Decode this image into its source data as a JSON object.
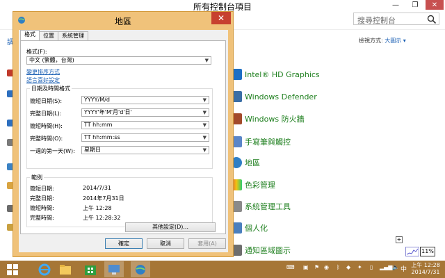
{
  "control_panel": {
    "title": "所有控制台項目",
    "search_placeholder": "搜尋控制台",
    "view_by_label": "檢視方式:",
    "view_by_value": "大圖示",
    "items": [
      {
        "label": "Intel® HD Graphics",
        "icon": "intel-graphics-icon"
      },
      {
        "label": "Windows Defender",
        "icon": "windows-defender-icon"
      },
      {
        "label": "Windows 防火牆",
        "icon": "windows-firewall-icon"
      },
      {
        "label": "手寫筆與觸控",
        "icon": "pen-touch-icon"
      },
      {
        "label": "地區",
        "icon": "region-icon"
      },
      {
        "label": "色彩管理",
        "icon": "color-management-icon"
      },
      {
        "label": "系統管理工具",
        "icon": "admin-tools-icon"
      },
      {
        "label": "個人化",
        "icon": "personalization-icon"
      },
      {
        "label": "通知區域圖示",
        "icon": "notification-area-icon"
      }
    ],
    "left_glimpse_letter": "調",
    "mini_percent": "11%"
  },
  "dialog": {
    "title": "地區",
    "close_glyph": "✕",
    "tabs": [
      "格式",
      "位置",
      "系統管理"
    ],
    "format_label": "格式(F):",
    "format_value": "中文 (繁體，台灣)",
    "link_sort": "變更排序方式",
    "link_language": "語言喜好設定",
    "datetime_group": "日期及時間格式",
    "fields": [
      {
        "label": "簡短日期(S):",
        "value": "YYYY/M/d"
      },
      {
        "label": "完整日期(L):",
        "value": "YYYY'年'M'月'd'日'"
      },
      {
        "label": "簡短時間(H):",
        "value": "TT hh:mm"
      },
      {
        "label": "完整時間(O):",
        "value": "TT hh:mm:ss"
      },
      {
        "label": "一週的第一天(W):",
        "value": "星期日"
      }
    ],
    "examples_group": "範例",
    "examples": [
      {
        "label": "簡短日期:",
        "value": "2014/7/31"
      },
      {
        "label": "完整日期:",
        "value": "2014年7月31日"
      },
      {
        "label": "簡短時間:",
        "value": "上午 12:28"
      },
      {
        "label": "完整時間:",
        "value": "上午 12:28:32"
      }
    ],
    "other_settings": "其他設定(D)...",
    "ok": "確定",
    "cancel": "取消",
    "apply": "套用(A)"
  },
  "taskbar": {
    "ime": "中",
    "time": "上午 12:28",
    "date": "2014/7/31"
  },
  "colors": {
    "dialog_frame": "#f0c27a",
    "taskbar": "#a67636",
    "link": "#1a5fb4",
    "cp_item_text": "#1e7f1e",
    "close_red": "#c7402f"
  }
}
